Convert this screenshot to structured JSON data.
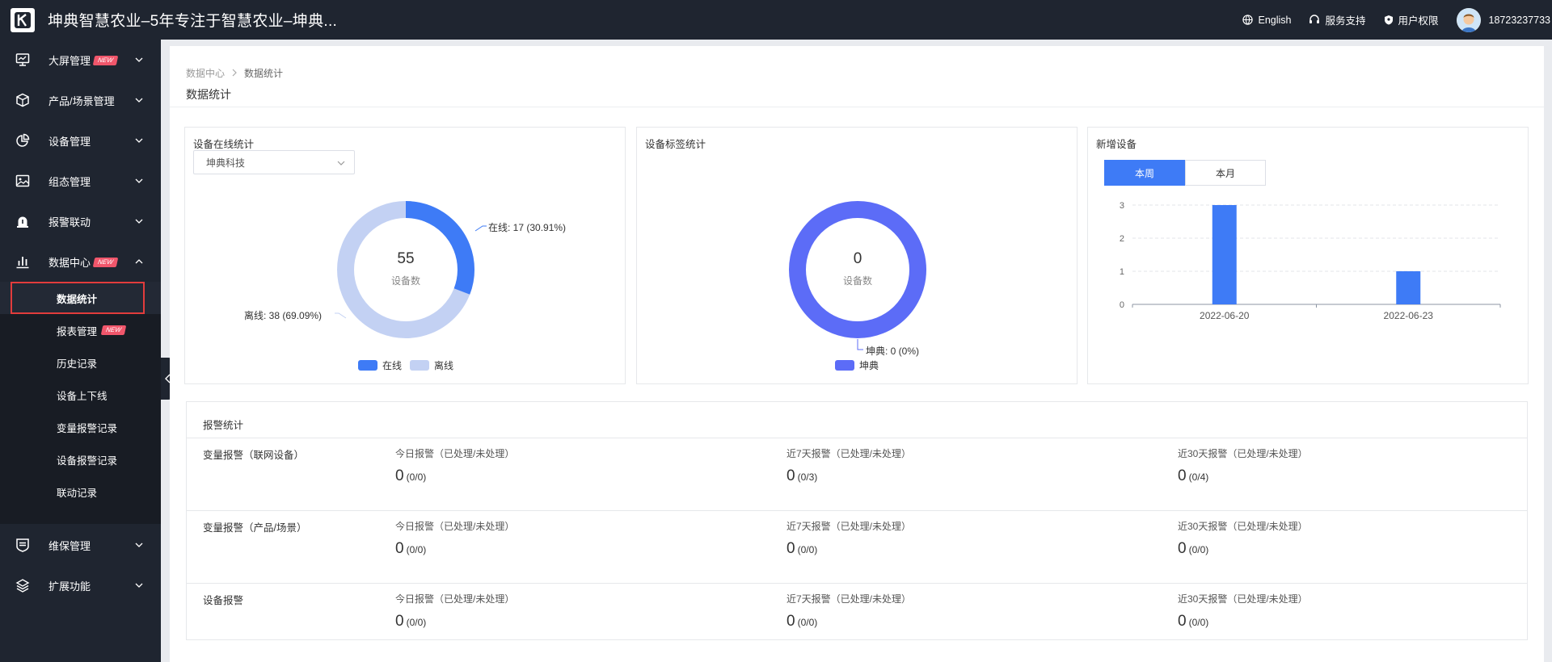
{
  "header": {
    "app_title": "坤典智慧农业–5年专注于智慧农业–坤典...",
    "language": "English",
    "support": "服务支持",
    "permissions": "用户权限",
    "phone": "18723237733"
  },
  "sidebar": {
    "items": [
      {
        "label": "大屏管理",
        "badge": "NEW",
        "icon": "monitor-icon",
        "expanded": false
      },
      {
        "label": "产品/场景管理",
        "badge": "",
        "icon": "cube-icon",
        "expanded": false
      },
      {
        "label": "设备管理",
        "badge": "",
        "icon": "pie-chart-icon",
        "expanded": false
      },
      {
        "label": "组态管理",
        "badge": "",
        "icon": "image-icon",
        "expanded": false
      },
      {
        "label": "报警联动",
        "badge": "",
        "icon": "alarm-icon",
        "expanded": false
      },
      {
        "label": "数据中心",
        "badge": "NEW",
        "icon": "bar-chart-icon",
        "expanded": true
      },
      {
        "label": "维保管理",
        "badge": "",
        "icon": "maintenance-icon",
        "expanded": false
      },
      {
        "label": "扩展功能",
        "badge": "",
        "icon": "layers-icon",
        "expanded": false
      }
    ],
    "submenu": [
      {
        "label": "数据统计",
        "badge": "",
        "active": true
      },
      {
        "label": "报表管理",
        "badge": "NEW",
        "active": false
      },
      {
        "label": "历史记录",
        "badge": "",
        "active": false
      },
      {
        "label": "设备上下线",
        "badge": "",
        "active": false
      },
      {
        "label": "变量报警记录",
        "badge": "",
        "active": false
      },
      {
        "label": "设备报警记录",
        "badge": "",
        "active": false
      },
      {
        "label": "联动记录",
        "badge": "",
        "active": false
      }
    ]
  },
  "breadcrumb": {
    "root": "数据中心",
    "current": "数据统计"
  },
  "page_title": "数据统计",
  "online_card": {
    "title": "设备在线统计",
    "select_value": "坤典科技",
    "total": "55",
    "total_label": "设备数",
    "online_callout": "在线: 17 (30.91%)",
    "offline_callout": "离线: 38 (69.09%)",
    "legend_online": "在线",
    "legend_offline": "离线",
    "online_color": "#3e7bf6",
    "offline_color": "#c3d1f3"
  },
  "tag_card": {
    "title": "设备标签统计",
    "total": "0",
    "total_label": "设备数",
    "callout": "坤典: 0 (0%)",
    "legend": "坤典",
    "color": "#5c6cf7"
  },
  "new_card": {
    "title": "新增设备",
    "tab_week": "本周",
    "tab_month": "本月",
    "active_tab": "本周"
  },
  "chart_data": {
    "type": "bar",
    "categories": [
      "2022-06-20",
      "2022-06-23"
    ],
    "values": [
      3,
      1
    ],
    "ylim": [
      0,
      3
    ],
    "yticks": [
      "0",
      "1",
      "2",
      "3"
    ],
    "bar_color": "#3e7bf6"
  },
  "alarm": {
    "title": "报警统计",
    "rows": [
      {
        "name": "变量报警（联网设备）",
        "stats": [
          {
            "label": "今日报警（已处理/未处理）",
            "value": "0",
            "detail": "(0/0)"
          },
          {
            "label": "近7天报警（已处理/未处理）",
            "value": "0",
            "detail": "(0/3)"
          },
          {
            "label": "近30天报警（已处理/未处理）",
            "value": "0",
            "detail": "(0/4)"
          }
        ]
      },
      {
        "name": "变量报警（产品/场景）",
        "stats": [
          {
            "label": "今日报警（已处理/未处理）",
            "value": "0",
            "detail": "(0/0)"
          },
          {
            "label": "近7天报警（已处理/未处理）",
            "value": "0",
            "detail": "(0/0)"
          },
          {
            "label": "近30天报警（已处理/未处理）",
            "value": "0",
            "detail": "(0/0)"
          }
        ]
      },
      {
        "name": "设备报警",
        "stats": [
          {
            "label": "今日报警（已处理/未处理）",
            "value": "0",
            "detail": "(0/0)"
          },
          {
            "label": "近7天报警（已处理/未处理）",
            "value": "0",
            "detail": "(0/0)"
          },
          {
            "label": "近30天报警（已处理/未处理）",
            "value": "0",
            "detail": "(0/0)"
          }
        ]
      }
    ]
  }
}
